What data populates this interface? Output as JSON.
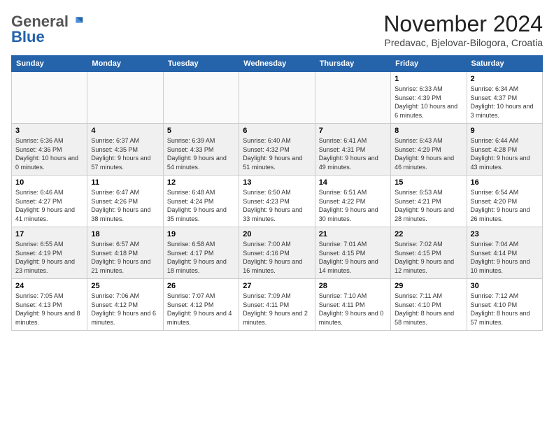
{
  "header": {
    "logo_general": "General",
    "logo_blue": "Blue",
    "month_title": "November 2024",
    "location": "Predavac, Bjelovar-Bilogora, Croatia"
  },
  "days_of_week": [
    "Sunday",
    "Monday",
    "Tuesday",
    "Wednesday",
    "Thursday",
    "Friday",
    "Saturday"
  ],
  "weeks": [
    [
      {
        "day": "",
        "empty": true
      },
      {
        "day": "",
        "empty": true
      },
      {
        "day": "",
        "empty": true
      },
      {
        "day": "",
        "empty": true
      },
      {
        "day": "",
        "empty": true
      },
      {
        "day": "1",
        "info": "Sunrise: 6:33 AM\nSunset: 4:39 PM\nDaylight: 10 hours and 6 minutes."
      },
      {
        "day": "2",
        "info": "Sunrise: 6:34 AM\nSunset: 4:37 PM\nDaylight: 10 hours and 3 minutes."
      }
    ],
    [
      {
        "day": "3",
        "info": "Sunrise: 6:36 AM\nSunset: 4:36 PM\nDaylight: 10 hours and 0 minutes."
      },
      {
        "day": "4",
        "info": "Sunrise: 6:37 AM\nSunset: 4:35 PM\nDaylight: 9 hours and 57 minutes."
      },
      {
        "day": "5",
        "info": "Sunrise: 6:39 AM\nSunset: 4:33 PM\nDaylight: 9 hours and 54 minutes."
      },
      {
        "day": "6",
        "info": "Sunrise: 6:40 AM\nSunset: 4:32 PM\nDaylight: 9 hours and 51 minutes."
      },
      {
        "day": "7",
        "info": "Sunrise: 6:41 AM\nSunset: 4:31 PM\nDaylight: 9 hours and 49 minutes."
      },
      {
        "day": "8",
        "info": "Sunrise: 6:43 AM\nSunset: 4:29 PM\nDaylight: 9 hours and 46 minutes."
      },
      {
        "day": "9",
        "info": "Sunrise: 6:44 AM\nSunset: 4:28 PM\nDaylight: 9 hours and 43 minutes."
      }
    ],
    [
      {
        "day": "10",
        "info": "Sunrise: 6:46 AM\nSunset: 4:27 PM\nDaylight: 9 hours and 41 minutes."
      },
      {
        "day": "11",
        "info": "Sunrise: 6:47 AM\nSunset: 4:26 PM\nDaylight: 9 hours and 38 minutes."
      },
      {
        "day": "12",
        "info": "Sunrise: 6:48 AM\nSunset: 4:24 PM\nDaylight: 9 hours and 35 minutes."
      },
      {
        "day": "13",
        "info": "Sunrise: 6:50 AM\nSunset: 4:23 PM\nDaylight: 9 hours and 33 minutes."
      },
      {
        "day": "14",
        "info": "Sunrise: 6:51 AM\nSunset: 4:22 PM\nDaylight: 9 hours and 30 minutes."
      },
      {
        "day": "15",
        "info": "Sunrise: 6:53 AM\nSunset: 4:21 PM\nDaylight: 9 hours and 28 minutes."
      },
      {
        "day": "16",
        "info": "Sunrise: 6:54 AM\nSunset: 4:20 PM\nDaylight: 9 hours and 26 minutes."
      }
    ],
    [
      {
        "day": "17",
        "info": "Sunrise: 6:55 AM\nSunset: 4:19 PM\nDaylight: 9 hours and 23 minutes."
      },
      {
        "day": "18",
        "info": "Sunrise: 6:57 AM\nSunset: 4:18 PM\nDaylight: 9 hours and 21 minutes."
      },
      {
        "day": "19",
        "info": "Sunrise: 6:58 AM\nSunset: 4:17 PM\nDaylight: 9 hours and 18 minutes."
      },
      {
        "day": "20",
        "info": "Sunrise: 7:00 AM\nSunset: 4:16 PM\nDaylight: 9 hours and 16 minutes."
      },
      {
        "day": "21",
        "info": "Sunrise: 7:01 AM\nSunset: 4:15 PM\nDaylight: 9 hours and 14 minutes."
      },
      {
        "day": "22",
        "info": "Sunrise: 7:02 AM\nSunset: 4:15 PM\nDaylight: 9 hours and 12 minutes."
      },
      {
        "day": "23",
        "info": "Sunrise: 7:04 AM\nSunset: 4:14 PM\nDaylight: 9 hours and 10 minutes."
      }
    ],
    [
      {
        "day": "24",
        "info": "Sunrise: 7:05 AM\nSunset: 4:13 PM\nDaylight: 9 hours and 8 minutes."
      },
      {
        "day": "25",
        "info": "Sunrise: 7:06 AM\nSunset: 4:12 PM\nDaylight: 9 hours and 6 minutes."
      },
      {
        "day": "26",
        "info": "Sunrise: 7:07 AM\nSunset: 4:12 PM\nDaylight: 9 hours and 4 minutes."
      },
      {
        "day": "27",
        "info": "Sunrise: 7:09 AM\nSunset: 4:11 PM\nDaylight: 9 hours and 2 minutes."
      },
      {
        "day": "28",
        "info": "Sunrise: 7:10 AM\nSunset: 4:11 PM\nDaylight: 9 hours and 0 minutes."
      },
      {
        "day": "29",
        "info": "Sunrise: 7:11 AM\nSunset: 4:10 PM\nDaylight: 8 hours and 58 minutes."
      },
      {
        "day": "30",
        "info": "Sunrise: 7:12 AM\nSunset: 4:10 PM\nDaylight: 8 hours and 57 minutes."
      }
    ]
  ]
}
